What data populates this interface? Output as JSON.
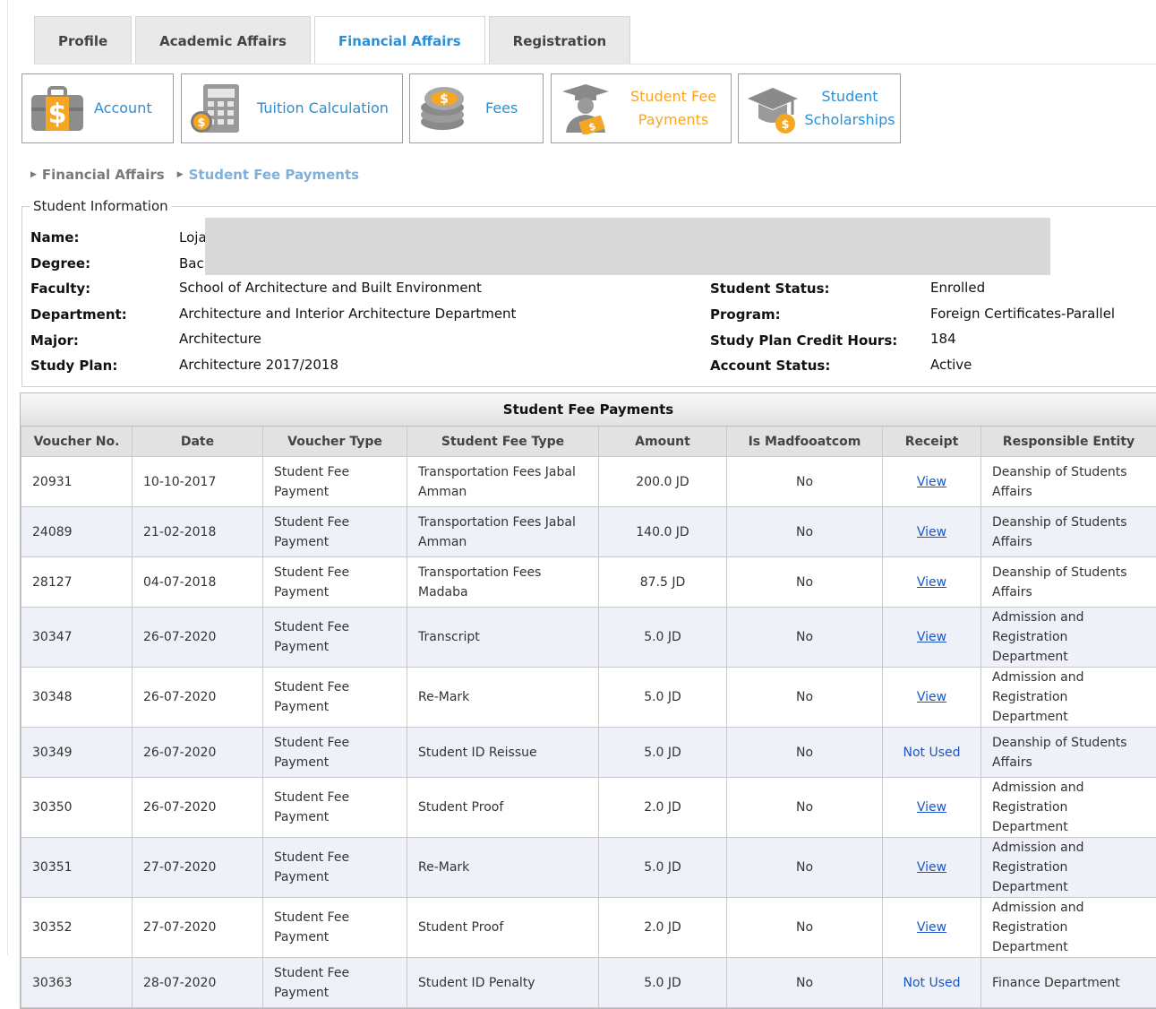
{
  "tabs": [
    {
      "label": "Profile",
      "active": false
    },
    {
      "label": "Academic Affairs",
      "active": false
    },
    {
      "label": "Financial Affairs",
      "active": true
    },
    {
      "label": "Registration",
      "active": false
    }
  ],
  "subnav": [
    {
      "label": "Account",
      "icon": "briefcase-dollar-icon",
      "active": false
    },
    {
      "label": "Tuition Calculation",
      "icon": "calculator-coin-icon",
      "active": false
    },
    {
      "label": "Fees",
      "icon": "coin-stack-icon",
      "active": false
    },
    {
      "label": "Student Fee Payments",
      "label_line1": "Student Fee",
      "label_line2": "Payments",
      "icon": "graduate-money-icon",
      "active": true
    },
    {
      "label": "Student Scholarships",
      "label_line1": "Student",
      "label_line2": "Scholarships",
      "icon": "graduation-cap-coin-icon",
      "active": false
    }
  ],
  "breadcrumb": {
    "items": [
      "Financial Affairs",
      "Student Fee Payments"
    ]
  },
  "student_info": {
    "legend": "Student Information",
    "left": [
      {
        "label": "Name:",
        "value": "Loja"
      },
      {
        "label": "Degree:",
        "value": "Bacl"
      },
      {
        "label": "Faculty:",
        "value": "School of Architecture and Built Environment"
      },
      {
        "label": "Department:",
        "value": "Architecture and Interior Architecture Department"
      },
      {
        "label": "Major:",
        "value": "Architecture"
      },
      {
        "label": "Study Plan:",
        "value": "Architecture 2017/2018"
      }
    ],
    "right": [
      {
        "label": "Student Status:",
        "value": "Enrolled"
      },
      {
        "label": "Program:",
        "value": "Foreign Certificates-Parallel"
      },
      {
        "label": "Study Plan Credit Hours:",
        "value": "184"
      },
      {
        "label": "Account Status:",
        "value": "Active"
      }
    ]
  },
  "payments": {
    "title": "Student Fee Payments",
    "columns": [
      "Voucher No.",
      "Date",
      "Voucher Type",
      "Student Fee Type",
      "Amount",
      "Is Madfooatcom",
      "Receipt",
      "Responsible Entity"
    ],
    "rows": [
      {
        "voucher": "20931",
        "date": "10-10-2017",
        "voucher_type": "Student Fee Payment",
        "fee_type": "Transportation Fees Jabal Amman",
        "amount": "200.0 JD",
        "madfooatcom": "No",
        "receipt": "View",
        "entity": "Deanship of Students Affairs"
      },
      {
        "voucher": "24089",
        "date": "21-02-2018",
        "voucher_type": "Student Fee Payment",
        "fee_type": "Transportation Fees Jabal Amman",
        "amount": "140.0 JD",
        "madfooatcom": "No",
        "receipt": "View",
        "entity": "Deanship of Students Affairs"
      },
      {
        "voucher": "28127",
        "date": "04-07-2018",
        "voucher_type": "Student Fee Payment",
        "fee_type": "Transportation Fees Madaba",
        "amount": "87.5 JD",
        "madfooatcom": "No",
        "receipt": "View",
        "entity": "Deanship of Students Affairs"
      },
      {
        "voucher": "30347",
        "date": "26-07-2020",
        "voucher_type": "Student Fee Payment",
        "fee_type": "Transcript",
        "amount": "5.0 JD",
        "madfooatcom": "No",
        "receipt": "View",
        "entity": "Admission and Registration Department"
      },
      {
        "voucher": "30348",
        "date": "26-07-2020",
        "voucher_type": "Student Fee Payment",
        "fee_type": "Re-Mark",
        "amount": "5.0 JD",
        "madfooatcom": "No",
        "receipt": "View",
        "entity": "Admission and Registration Department"
      },
      {
        "voucher": "30349",
        "date": "26-07-2020",
        "voucher_type": "Student Fee Payment",
        "fee_type": "Student ID Reissue",
        "amount": "5.0 JD",
        "madfooatcom": "No",
        "receipt": "Not Used",
        "entity": "Deanship of Students Affairs"
      },
      {
        "voucher": "30350",
        "date": "26-07-2020",
        "voucher_type": "Student Fee Payment",
        "fee_type": "Student Proof",
        "amount": "2.0 JD",
        "madfooatcom": "No",
        "receipt": "View",
        "entity": "Admission and Registration Department"
      },
      {
        "voucher": "30351",
        "date": "27-07-2020",
        "voucher_type": "Student Fee Payment",
        "fee_type": "Re-Mark",
        "amount": "5.0 JD",
        "madfooatcom": "No",
        "receipt": "View",
        "entity": "Admission and Registration Department"
      },
      {
        "voucher": "30352",
        "date": "27-07-2020",
        "voucher_type": "Student Fee Payment",
        "fee_type": "Student Proof",
        "amount": "2.0 JD",
        "madfooatcom": "No",
        "receipt": "View",
        "entity": "Admission and Registration Department"
      },
      {
        "voucher": "30363",
        "date": "28-07-2020",
        "voucher_type": "Student Fee Payment",
        "fee_type": "Student ID Penalty",
        "amount": "5.0 JD",
        "madfooatcom": "No",
        "receipt": "Not Used",
        "entity": "Finance Department"
      }
    ]
  }
}
